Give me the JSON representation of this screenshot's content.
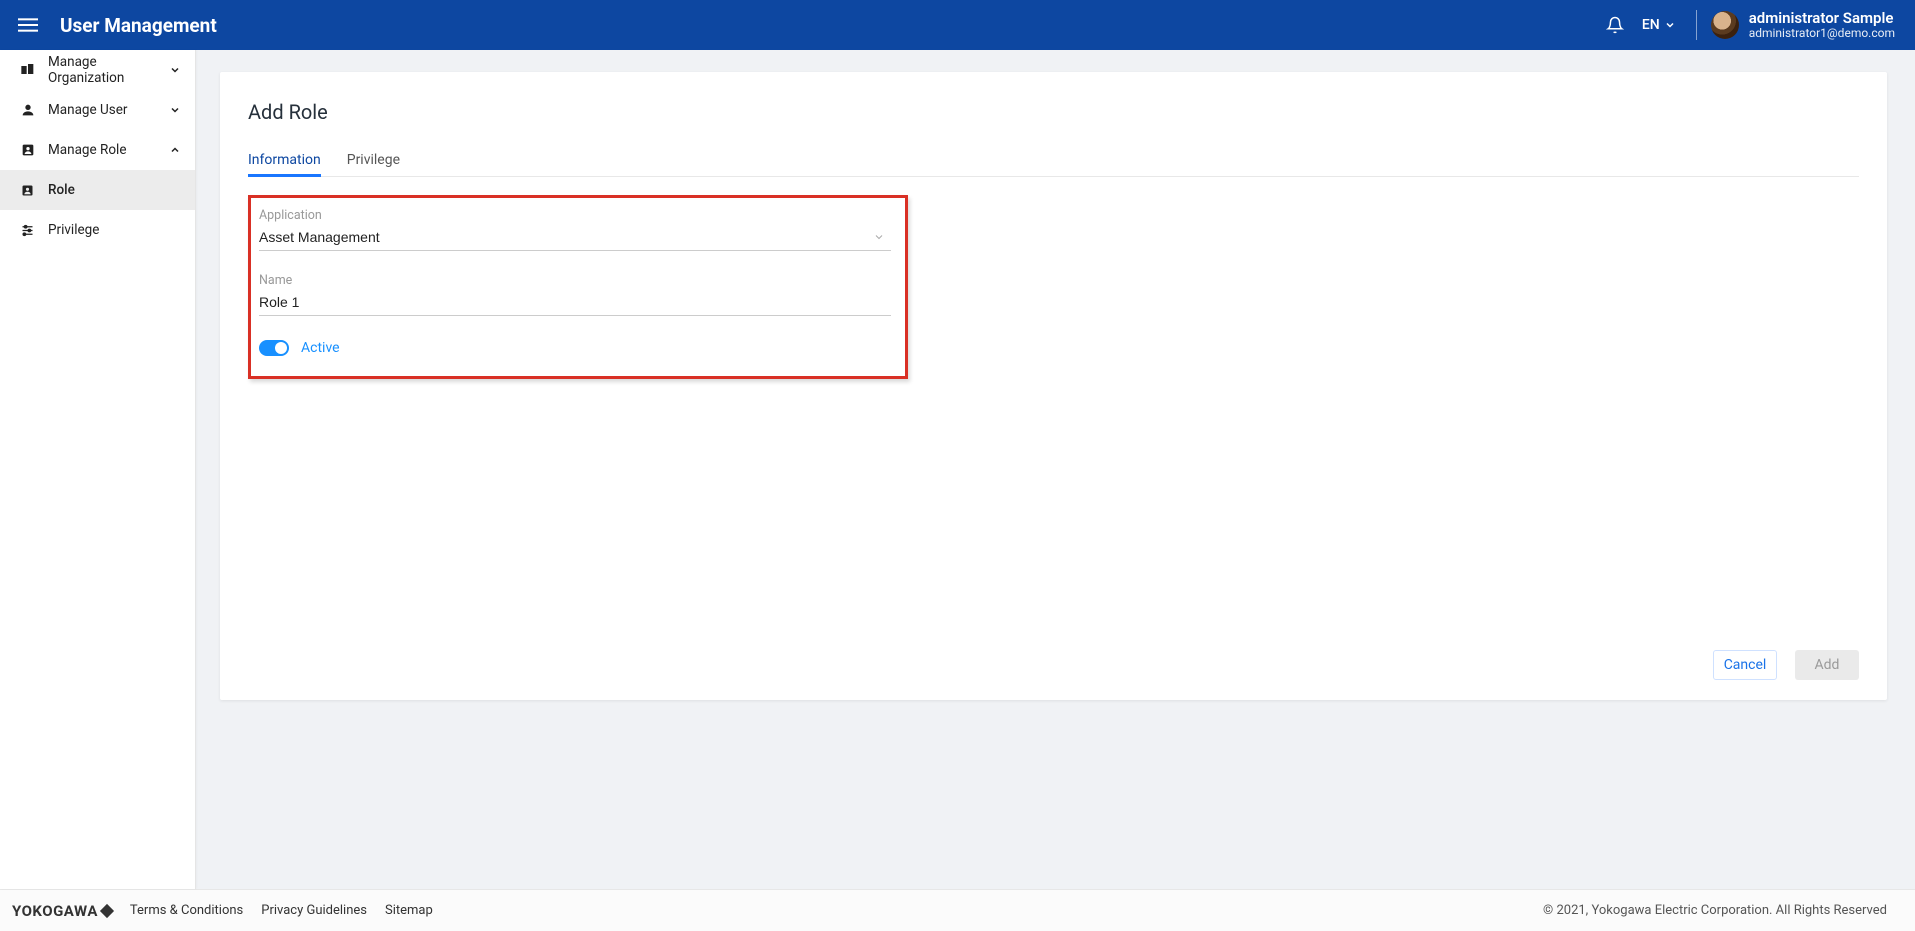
{
  "header": {
    "title": "User Management",
    "language": "EN",
    "user_name": "administrator Sample",
    "user_email": "administrator1@demo.com"
  },
  "sidebar": {
    "items": [
      {
        "label": "Manage Organization",
        "expanded": false
      },
      {
        "label": "Manage User",
        "expanded": false
      },
      {
        "label": "Manage Role",
        "expanded": true
      }
    ],
    "sub_items": [
      {
        "label": "Role",
        "active": true
      },
      {
        "label": "Privilege",
        "active": false
      }
    ]
  },
  "page": {
    "heading": "Add Role",
    "tabs": [
      {
        "label": "Information",
        "active": true
      },
      {
        "label": "Privilege",
        "active": false
      }
    ],
    "form": {
      "application_label": "Application",
      "application_value": "Asset Management",
      "name_label": "Name",
      "name_value": "Role 1",
      "active_label": "Active"
    },
    "buttons": {
      "cancel": "Cancel",
      "add": "Add"
    }
  },
  "footer": {
    "brand": "YOKOGAWA",
    "links": [
      "Terms & Conditions",
      "Privacy Guidelines",
      "Sitemap"
    ],
    "copyright": "© 2021, Yokogawa Electric Corporation. All Rights Reserved"
  }
}
